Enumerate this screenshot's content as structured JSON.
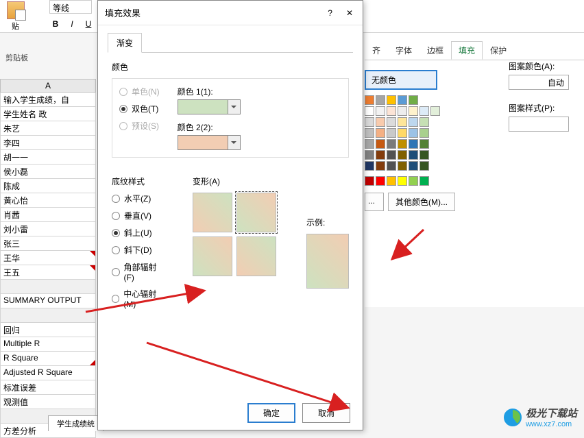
{
  "ribbon": {
    "font_name": "等线",
    "paste_label": "贴",
    "clipboard_label": "剪贴板",
    "bold": "B",
    "italic": "I",
    "underline": "U"
  },
  "grid": {
    "column_header": "A",
    "rows": [
      "输入学生成绩，自",
      "学生姓名                政",
      "朱艺",
      "李四",
      "胡一一",
      "侯小磊",
      "陈成",
      "黄心怡",
      "肖茜",
      "刘小雷",
      "张三",
      "王华",
      "王五",
      "",
      "SUMMARY OUTPUT",
      "",
      "                           回归",
      "Multiple R",
      "R Square",
      "Adjusted R Square",
      "标准误差",
      "观测值",
      "",
      "方差分析"
    ],
    "sheet_tab": "学生成绩统"
  },
  "format_panel": {
    "tabs": [
      "齐",
      "字体",
      "边框",
      "填充",
      "保护"
    ],
    "active_tab": "填充",
    "nocolor": "无颜色",
    "other_colors": "其他颜色(M)...",
    "pattern_color_label": "图案颜色(A):",
    "auto_label": "自动",
    "pattern_style_label": "图案样式(P):"
  },
  "dialog": {
    "title": "填充效果",
    "help": "?",
    "close": "✕",
    "tab": "渐变",
    "color_section": "颜色",
    "radio_single": "单色(N)",
    "radio_double": "双色(T)",
    "radio_preset": "预设(S)",
    "color1_label": "颜色 1(1):",
    "color2_label": "颜色 2(2):",
    "shading_section": "底纹样式",
    "radio_horizontal": "水平(Z)",
    "radio_vertical": "垂直(V)",
    "radio_diag_up": "斜上(U)",
    "radio_diag_down": "斜下(D)",
    "radio_corner": "角部辐射(F)",
    "radio_center": "中心辐射(M)",
    "variants_label": "变形(A)",
    "sample_label": "示例:",
    "ok": "确定",
    "cancel": "取消"
  },
  "colors": {
    "palette": [
      [
        "#ed7d31",
        "#a5a5a5",
        "#ffc000",
        "#5b9bd5",
        "#70ad47"
      ],
      [
        "#ffffff",
        "#f2f2f2",
        "#fce4d6",
        "#ededed",
        "#fff2cc",
        "#ddebf7",
        "#e2efda"
      ],
      [
        "#d9d9d9",
        "#f8cbad",
        "#dbdbdb",
        "#ffe699",
        "#bdd7ee",
        "#c6e0b4"
      ],
      [
        "#bfbfbf",
        "#f4b084",
        "#c9c9c9",
        "#ffd966",
        "#9bc2e6",
        "#a9d08e"
      ],
      [
        "#a6a6a6",
        "#c65911",
        "#7b7b7b",
        "#bf8f00",
        "#2f75b5",
        "#548235"
      ],
      [
        "#808080",
        "#833c0c",
        "#525252",
        "#806000",
        "#1f4e78",
        "#375623"
      ],
      [
        "#203764",
        "#833c0c",
        "#525252",
        "#806000",
        "#1f4e78",
        "#375623"
      ]
    ],
    "standard": [
      "#c00000",
      "#ff0000",
      "#ffc000",
      "#ffff00",
      "#92d050",
      "#00b050"
    ]
  },
  "watermark": {
    "name": "极光下载站",
    "url": "www.xz7.com"
  }
}
